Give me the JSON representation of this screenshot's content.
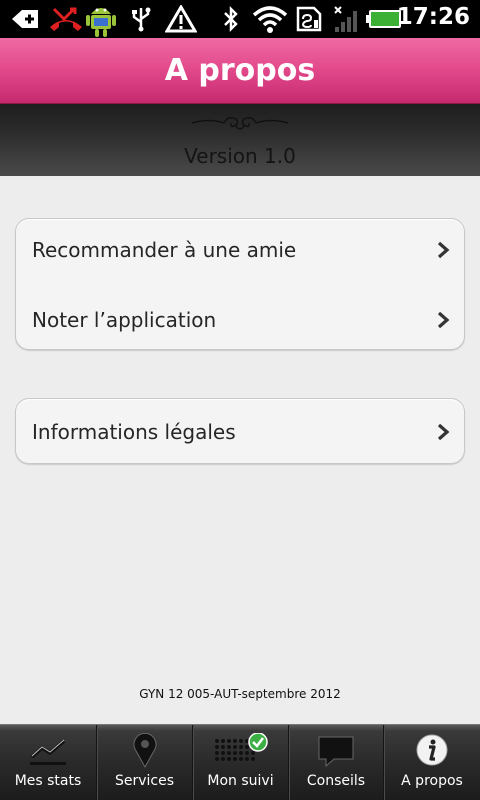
{
  "status_bar": {
    "time": "17:26",
    "icons": [
      "notification-icon",
      "missed-call-icon",
      "android-debug-icon",
      "usb-icon",
      "warning-icon",
      "bluetooth-icon",
      "wifi-icon",
      "sd-card-icon",
      "no-signal-icon",
      "battery-icon"
    ]
  },
  "header": {
    "title": "A propos",
    "version": "Version 1.0"
  },
  "menu": {
    "group1": [
      {
        "label": "Recommander à une amie"
      },
      {
        "label": "Noter l’application"
      }
    ],
    "group2": [
      {
        "label": "Informations légales"
      }
    ]
  },
  "footer": {
    "note": "GYN 12 005-AUT-septembre 2012"
  },
  "tabs": [
    {
      "label": "Mes stats",
      "icon": "chart-icon"
    },
    {
      "label": "Services",
      "icon": "map-pin-icon"
    },
    {
      "label": "Mon suivi",
      "icon": "calendar-check-icon"
    },
    {
      "label": "Conseils",
      "icon": "speech-bubble-icon"
    },
    {
      "label": "A propos",
      "icon": "info-icon"
    }
  ],
  "colors": {
    "title_bar": "#e34b8d",
    "tab_bar": "#2a2a2a",
    "background": "#ededed",
    "check_badge": "#3cb044"
  }
}
